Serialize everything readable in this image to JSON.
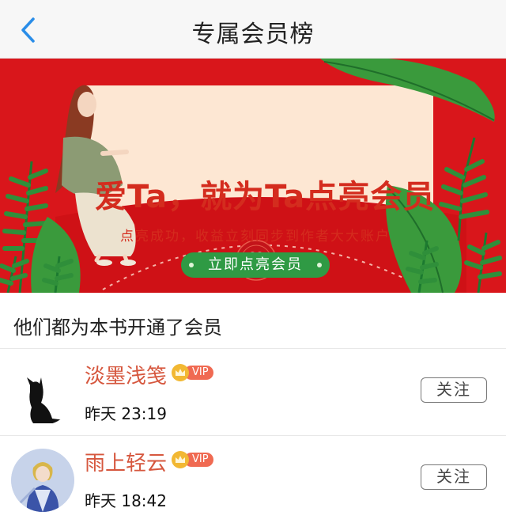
{
  "header": {
    "title": "专属会员榜",
    "back_icon": "chevron-left-icon"
  },
  "banner": {
    "headline": "爱Ta，就为Ta点亮会员",
    "subtitle": "点亮成功，收益立刻同步到作者大大账户",
    "button_label": "立即点亮会员",
    "colors": {
      "background": "#d9161b",
      "card": "#fde7d3",
      "accent_green": "#2f9a44",
      "headline": "#d42c1e"
    }
  },
  "section": {
    "title": "他们都为本书开通了会员"
  },
  "members": [
    {
      "name": "淡墨浅笺",
      "vip_label": "VIP",
      "time": "昨天 23:19",
      "follow_label": "关注",
      "avatar": "black-cat-avatar"
    },
    {
      "name": "雨上轻云",
      "vip_label": "VIP",
      "time": "昨天 18:42",
      "follow_label": "关注",
      "avatar": "anime-knight-avatar"
    }
  ]
}
